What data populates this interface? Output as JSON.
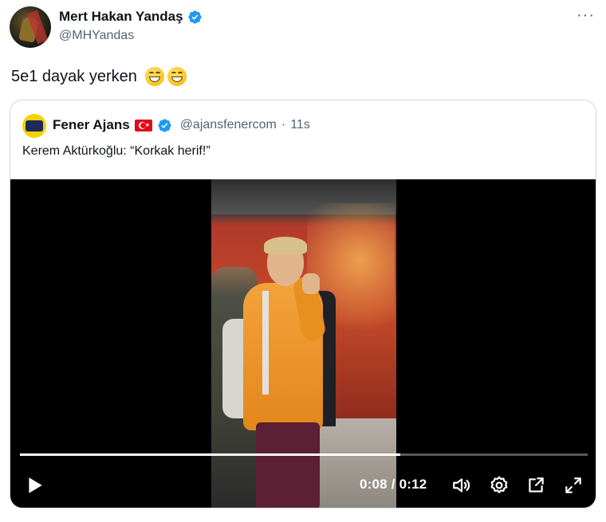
{
  "tweet": {
    "author_name": "Mert Hakan Yandaş",
    "author_handle": "@MHYandas",
    "text": "5e1 dayak yerken",
    "emoji": [
      "grinning-face-with-smiling-eyes-emoji",
      "grinning-face-with-smiling-eyes-emoji"
    ],
    "more_icon": "more-options-icon",
    "more_glyph": "···"
  },
  "quote": {
    "author_name": "Fener Ajans",
    "author_handle": "@ajansfenercom",
    "separator": "·",
    "time_ago": "11s",
    "text": "Kerem Aktürkoğlu: “Korkak herif!”",
    "flag": "turkey-flag-icon"
  },
  "video": {
    "time_current": "0:08",
    "time_separator": "/",
    "time_total": "0:12",
    "progress": 0.67,
    "controls": [
      "play-icon",
      "volume-icon",
      "settings-icon",
      "popout-icon",
      "fullscreen-icon"
    ]
  },
  "colors": {
    "verified_blue": "#1d9bf0",
    "text_primary": "#0f1419",
    "text_secondary": "#536471",
    "border": "#cfd9de"
  }
}
